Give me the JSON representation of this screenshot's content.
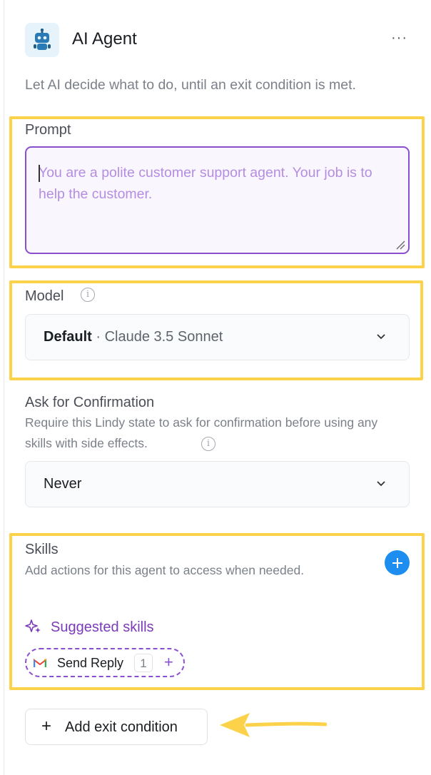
{
  "node": {
    "title": "AI Agent",
    "more_label": "···",
    "description": "Let AI decide what to do, until an exit condition is met."
  },
  "prompt": {
    "label": "Prompt",
    "placeholder": "You are a polite customer support agent. Your job is to help the customer."
  },
  "model": {
    "label": "Model",
    "value_bold": "Default",
    "value_rest": " · Claude 3.5 Sonnet"
  },
  "confirmation": {
    "label": "Ask for Confirmation",
    "description": "Require this Lindy state to ask for confirmation before using any skills with side effects.",
    "value": "Never"
  },
  "skills": {
    "label": "Skills",
    "description": "Add actions for this agent to access when needed.",
    "suggested_label": "Suggested skills",
    "suggested": [
      {
        "name": "Send Reply",
        "count": "1",
        "icon": "gmail-icon"
      }
    ]
  },
  "exit": {
    "plus": "+",
    "label": "Add exit condition"
  },
  "colors": {
    "highlight": "#fcd24a",
    "accent_purple": "#8a4fcf",
    "accent_blue": "#1d8ef0"
  }
}
